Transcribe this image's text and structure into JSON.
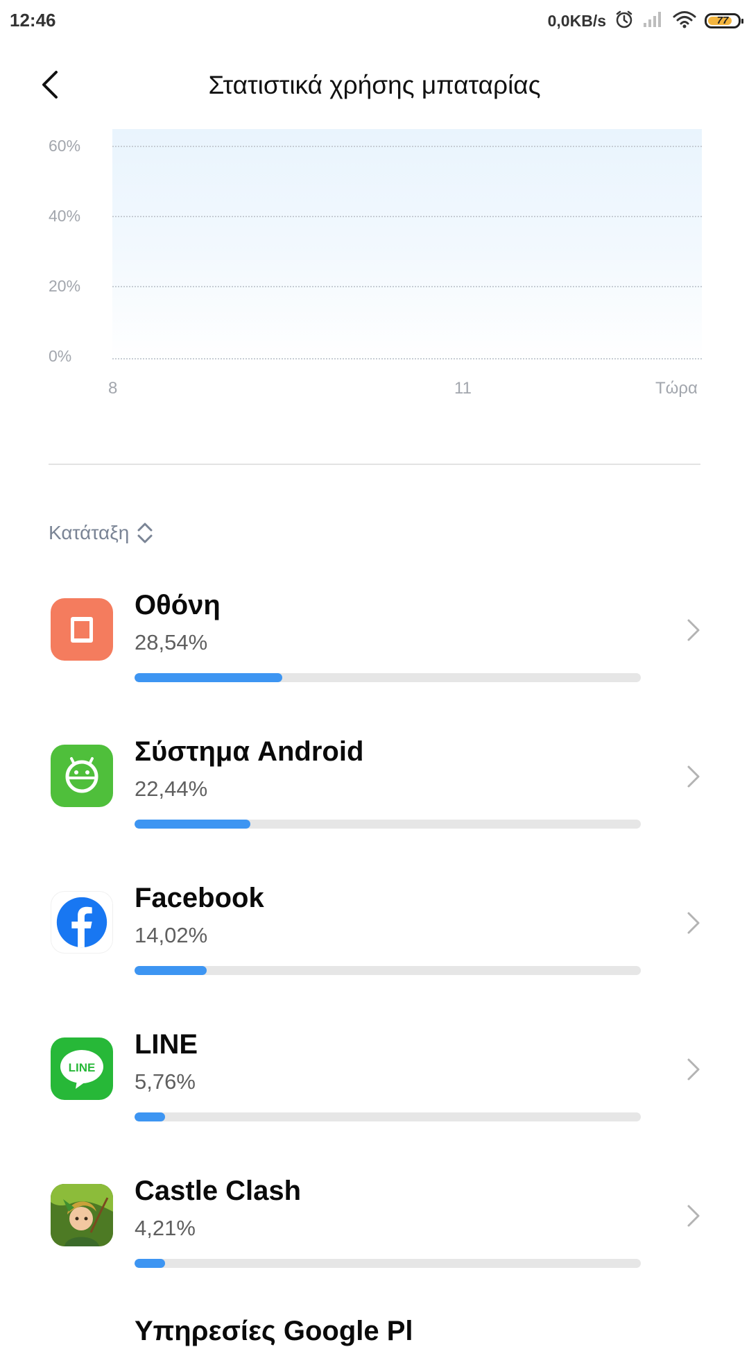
{
  "status_bar": {
    "time": "12:46",
    "network_speed": "0,0KB/s",
    "battery_level": "77",
    "battery_fraction": 0.77,
    "battery_color": "#f3b53f",
    "icons": [
      "alarm-icon",
      "signal-icon",
      "wifi-icon",
      "battery-icon"
    ]
  },
  "header": {
    "back_icon": "chevron-left-icon",
    "title": "Στατιστικά χρήσης μπαταρίας"
  },
  "chart_data": {
    "type": "area",
    "title": "",
    "xlabel": "",
    "ylabel": "",
    "y_ticks": [
      "60%",
      "40%",
      "20%",
      "0%"
    ],
    "x_ticks": [
      "8",
      "11",
      "Τώρα"
    ],
    "ylim": [
      0,
      60
    ],
    "grid": true,
    "fill_color": "#e9f4fd"
  },
  "sort": {
    "label": "Κατάταξη",
    "icon": "sort-updown-icon",
    "accent": "#7a8495"
  },
  "apps": [
    {
      "name": "Οθόνη",
      "percent": "28,54%",
      "share": 28.54,
      "icon": "screen-icon",
      "icon_color": "#f47c5e"
    },
    {
      "name": "Σύστημα Android",
      "percent": "22,44%",
      "share": 22.44,
      "icon": "android-icon",
      "icon_color": "#4fbf3b"
    },
    {
      "name": "Facebook",
      "percent": "14,02%",
      "share": 14.02,
      "icon": "facebook-icon",
      "icon_color": "#1877f2"
    },
    {
      "name": "LINE",
      "percent": "5,76%",
      "share": 5.76,
      "icon": "line-icon",
      "icon_color": "#27b838"
    },
    {
      "name": "Castle Clash",
      "percent": "4,21%",
      "share": 4.21,
      "icon": "castle-clash-icon",
      "icon_color": "#6f9a2c"
    }
  ],
  "partial_item": {
    "name": "Υπηρεσίες Google Pl"
  },
  "bar_color": "#3d95f2",
  "bar_track_color": "#e6e6e6"
}
